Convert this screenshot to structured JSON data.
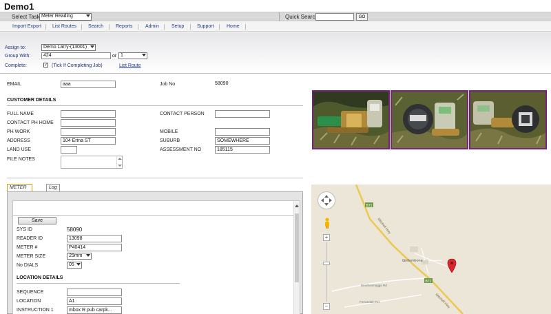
{
  "app_title": "Demo1",
  "taskbar": {
    "select_task_label": "Select Task:",
    "select_task_value": "Meter Reading",
    "quick_search_label": "Quick Search:",
    "quick_search_value": "",
    "go_label": "GO"
  },
  "menu": {
    "items": [
      "Import Export",
      "List Routes",
      "Search",
      "Reports",
      "Admin",
      "Setup",
      "Support",
      "Home"
    ]
  },
  "assign": {
    "assign_label": "Assign to:",
    "assign_value": "Demo Larry-(13001)",
    "group_label": "Group With:",
    "group_value": "424",
    "or_label": "or",
    "group_alt_value": "1",
    "complete_label": "Complete:",
    "complete_checked": "✓",
    "complete_hint": "(Tick If Completing Job)",
    "list_route_link": "List Route"
  },
  "top": {
    "email_label": "EMAIL",
    "email_value": "aaa",
    "job_no_label": "Job No",
    "job_no_value": "58090"
  },
  "customer": {
    "heading": "CUSTOMER DETAILS",
    "full_name_label": "FULL NAME",
    "full_name_value": "",
    "contact_ph_home_label": "CONTACT PH HOME",
    "contact_ph_home_value": "",
    "ph_work_label": "PH WORK",
    "ph_work_value": "",
    "address_label": "ADDRESS",
    "address_value": "104 Erina ST",
    "land_use_label": "LAND USE",
    "land_use_value": "",
    "file_notes_label": "FILE NOTES",
    "file_notes_value": "",
    "contact_person_label": "CONTACT PERSON",
    "contact_person_value": "",
    "mobile_label": "MOBILE",
    "mobile_value": "",
    "suburb_label": "SUBURB",
    "suburb_value": "SOMEWHERE",
    "assessment_no_label": "ASSESSMENT NO",
    "assessment_no_value": "185115"
  },
  "tabs": [
    "METER DETAILS",
    "Log"
  ],
  "meter": {
    "save_label": "Save",
    "sys_id_label": "SYS ID",
    "sys_id_value": "58090",
    "reader_id_label": "READER ID",
    "reader_id_value": "13098",
    "meter_no_label": "METER #",
    "meter_no_value": "P40414",
    "meter_size_label": "METER SIZE",
    "meter_size_value": "25mm",
    "no_dials_label": "No DIALS",
    "no_dials_value": "05"
  },
  "location": {
    "heading": "LOCATION DETAILS",
    "sequence_label": "SEQUENCE",
    "sequence_value": "",
    "location_label": "LOCATION",
    "location_value": "A1",
    "instruction_label": "INSTRUCTION 1",
    "instruction_value": "mbox R pub carpk..."
  },
  "map": {
    "road_shield_1": "B71",
    "road_shield_2": "B71",
    "road_name": "Mitchell Hwy",
    "town_name": "Girilambone",
    "minor_road_1": "Bearbonmagga Rd",
    "minor_road_2": "Ferrandale Rd",
    "zoom_in": "+",
    "zoom_out": "−",
    "marker_color": "#d9262c"
  },
  "colors": {
    "photo_border": "#7a1f7a",
    "active_tab_border": "#d49a1a",
    "link": "#1b3fa0"
  }
}
